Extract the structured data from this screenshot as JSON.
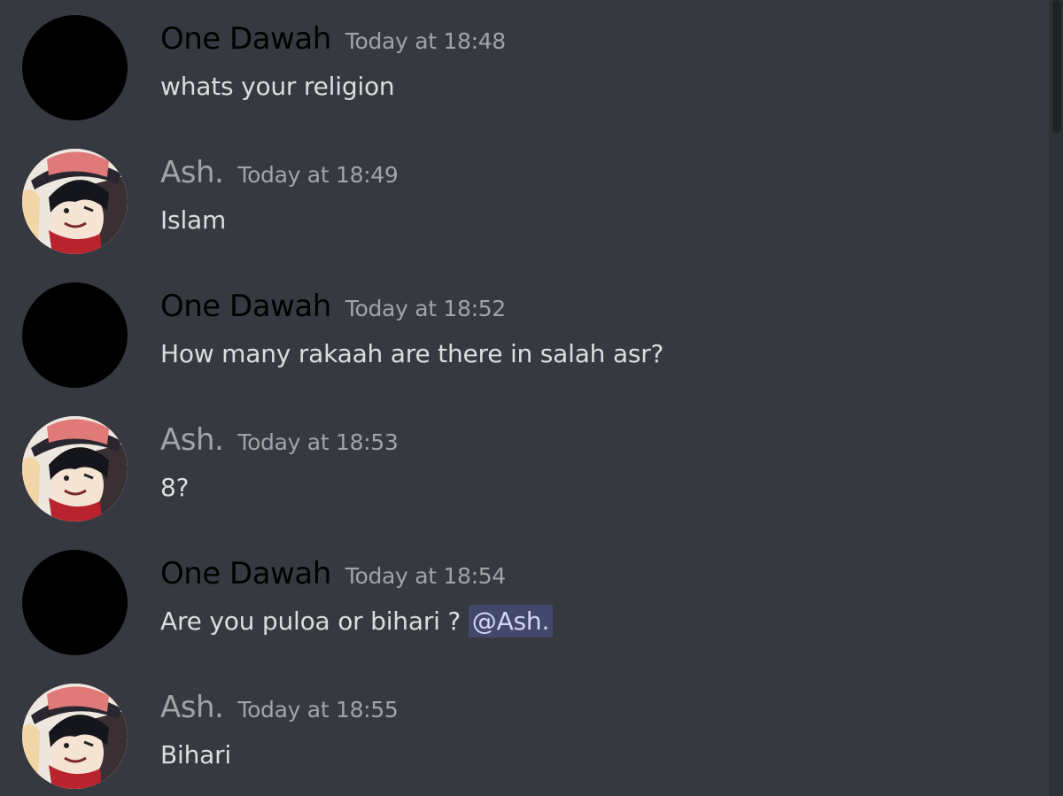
{
  "colors": {
    "background": "#36393f",
    "one_dawah_name": "#000000",
    "ash_name": "#a1a3a7",
    "timestamp": "#a1a3a7",
    "text": "#dcddde",
    "mention_bg": "#43476b",
    "mention_text": "#d2d6f7"
  },
  "messages": [
    {
      "author": "One Dawah",
      "timestamp": "Today at 18:48",
      "text": "whats your religion",
      "avatar": "black-circle-avatar"
    },
    {
      "author": "Ash.",
      "timestamp": "Today at 18:49",
      "text": "Islam",
      "avatar": "anime-character-avatar"
    },
    {
      "author": "One Dawah",
      "timestamp": "Today at 18:52",
      "text": "How many rakaah are there in salah asr?",
      "avatar": "black-circle-avatar"
    },
    {
      "author": "Ash.",
      "timestamp": "Today at 18:53",
      "text": "8?",
      "avatar": "anime-character-avatar"
    },
    {
      "author": "One Dawah",
      "timestamp": "Today at 18:54",
      "text": "Are you puloa or bihari ?",
      "mention": "@Ash.",
      "avatar": "black-circle-avatar"
    },
    {
      "author": "Ash.",
      "timestamp": "Today at 18:55",
      "text": "Bihari",
      "avatar": "anime-character-avatar"
    }
  ]
}
